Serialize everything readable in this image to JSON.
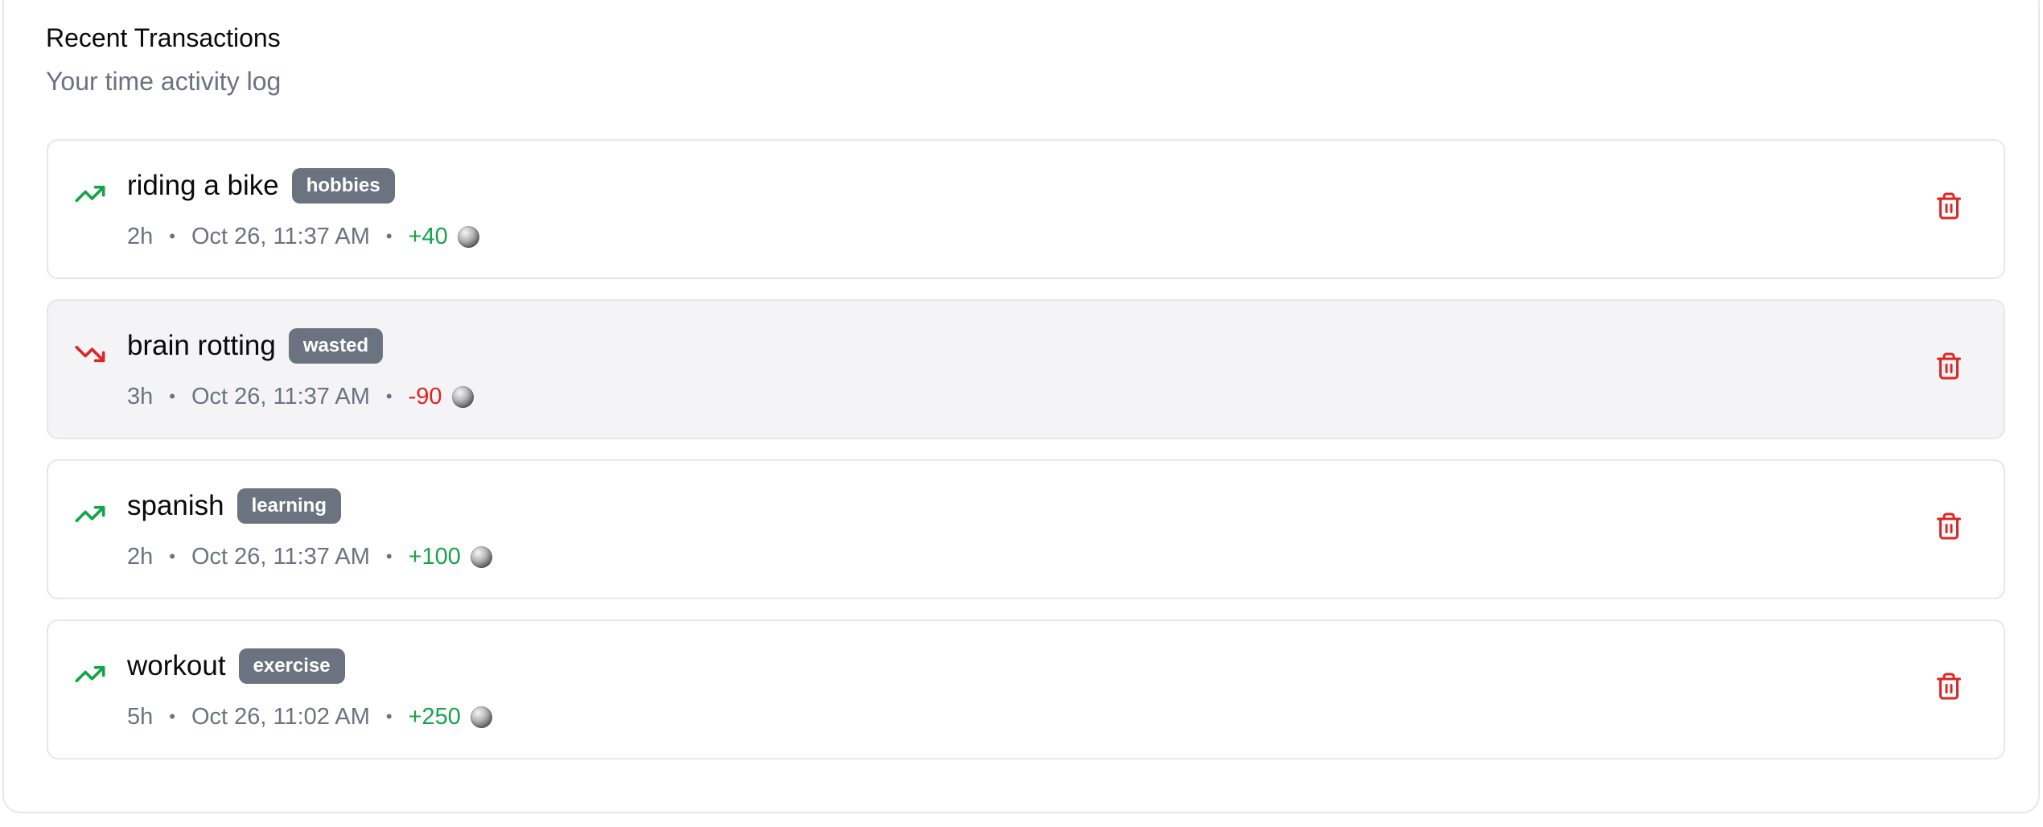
{
  "header": {
    "title": "Recent Transactions",
    "subtitle": "Your time activity log"
  },
  "colors": {
    "positive": "#16a34a",
    "negative": "#dc2626",
    "badge": "#6b7280",
    "delete": "#dc2626"
  },
  "transactions": [
    {
      "title": "riding a bike",
      "category": "hobbies",
      "duration": "2h",
      "timestamp": "Oct 26, 11:37 AM",
      "amount": "+40",
      "trend_icon": "trending-up-icon",
      "direction": "positive"
    },
    {
      "title": "brain rotting",
      "category": "wasted",
      "duration": "3h",
      "timestamp": "Oct 26, 11:37 AM",
      "amount": "-90",
      "trend_icon": "trending-down-icon",
      "direction": "negative"
    },
    {
      "title": "spanish",
      "category": "learning",
      "duration": "2h",
      "timestamp": "Oct 26, 11:37 AM",
      "amount": "+100",
      "trend_icon": "trending-up-icon",
      "direction": "positive"
    },
    {
      "title": "workout",
      "category": "exercise",
      "duration": "5h",
      "timestamp": "Oct 26, 11:02 AM",
      "amount": "+250",
      "trend_icon": "trending-up-icon",
      "direction": "positive"
    }
  ],
  "separator": "•",
  "delete_icon": "trash-icon",
  "currency_icon": "coin-icon"
}
